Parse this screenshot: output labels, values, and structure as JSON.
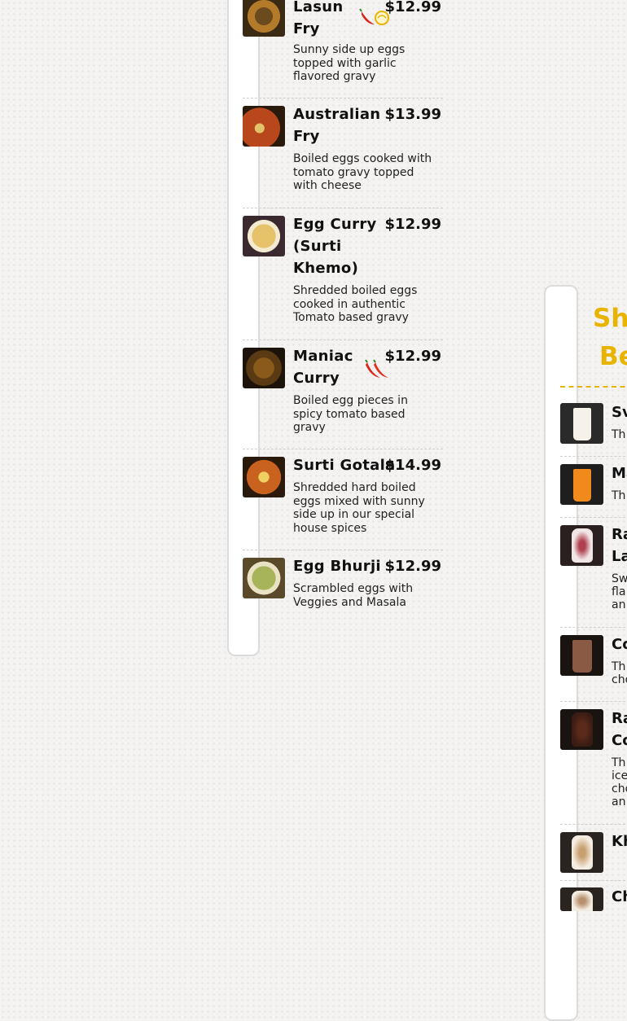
{
  "menu_items": [
    {
      "name_lines": [
        "Lasun",
        "Fry"
      ],
      "price": "$12.99",
      "desc_lines": [
        "Sunny side up eggs",
        "topped with garlic",
        "flavored gravy"
      ],
      "icon": "chili-garlic-icon"
    },
    {
      "name_lines": [
        "Australian",
        "Fry"
      ],
      "price": "$13.99",
      "desc_lines": [
        "Boiled eggs cooked with",
        "tomato gravy topped",
        "with cheese"
      ]
    },
    {
      "name_lines": [
        "Egg Curry",
        "(Surti",
        "Khemo)"
      ],
      "price": "$12.99",
      "desc_lines": [
        "Shredded boiled eggs",
        "cooked in authentic",
        "Tomato based gravy"
      ]
    },
    {
      "name_lines": [
        "Maniac",
        "Curry"
      ],
      "price": "$12.99",
      "desc_lines": [
        "Boiled egg pieces in",
        "spicy tomato based",
        "gravy"
      ],
      "icon": "double-chili-icon"
    },
    {
      "name_lines": [
        "Surti Gotala"
      ],
      "price": "$14.99",
      "desc_lines": [
        "Shredded hard boiled",
        "eggs mixed with sunny",
        "side up in our special",
        "house spices"
      ]
    },
    {
      "name_lines": [
        "Egg Bhurji"
      ],
      "price": "$12.99",
      "desc_lines": [
        "Scrambled eggs with",
        "Veggies and Masala"
      ]
    }
  ],
  "right_section": {
    "title_lines": [
      "Sh",
      "Be"
    ],
    "items": [
      {
        "name": "Sv",
        "desc_lines": [
          "Th"
        ]
      },
      {
        "name": "Ma",
        "desc_lines": [
          "Th"
        ]
      },
      {
        "name_lines": [
          "Ra",
          "La"
        ],
        "desc_lines": [
          "Sw",
          "fla",
          "an"
        ]
      },
      {
        "name": "Co",
        "desc_lines": [
          "Th",
          "cho"
        ]
      },
      {
        "name_lines": [
          "Ra",
          "Co"
        ],
        "desc_lines": [
          "Th",
          "ice",
          "cho",
          "an"
        ]
      },
      {
        "name": "Kh"
      },
      {
        "name": "Ch"
      }
    ]
  },
  "colors": {
    "accent": "#e8b400",
    "chili": "#d9261c"
  }
}
